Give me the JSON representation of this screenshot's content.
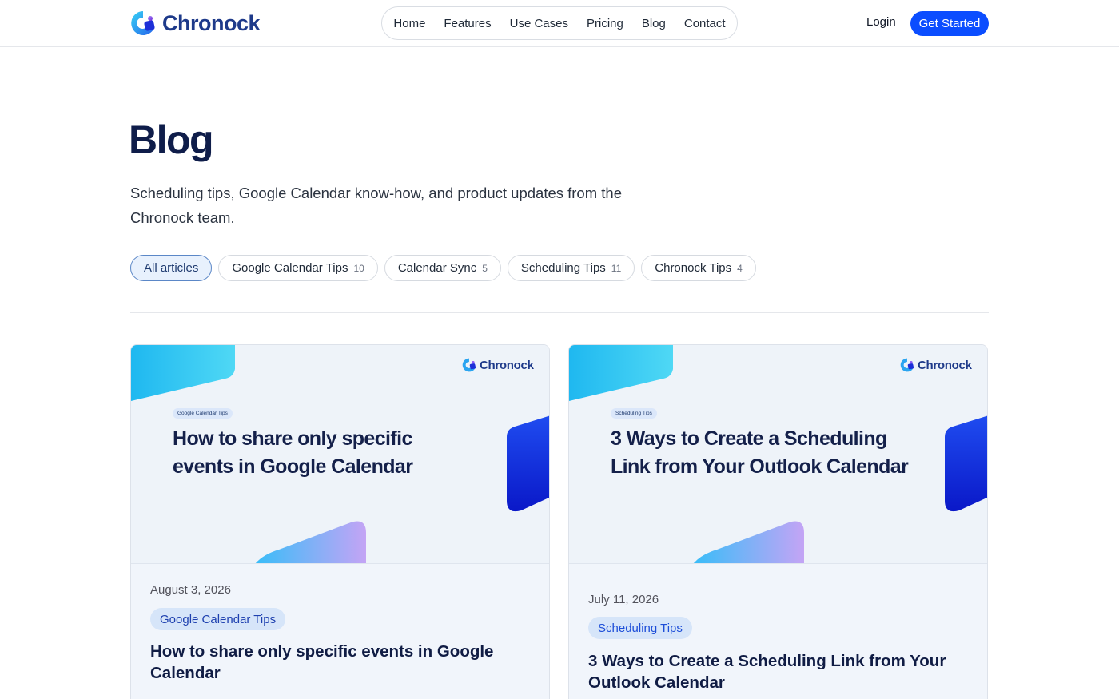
{
  "brand": {
    "name": "Chronock"
  },
  "nav": {
    "items": [
      "Home",
      "Features",
      "Use Cases",
      "Pricing",
      "Blog",
      "Contact"
    ]
  },
  "header": {
    "login": "Login",
    "cta": "Get Started"
  },
  "hero": {
    "title": "Blog",
    "subtitle": "Scheduling tips, Google Calendar know-how, and product updates from the Chronock team."
  },
  "filters": [
    {
      "label": "All articles",
      "count": "",
      "active": true
    },
    {
      "label": "Google Calendar Tips",
      "count": "10",
      "active": false
    },
    {
      "label": "Calendar Sync",
      "count": "5",
      "active": false
    },
    {
      "label": "Scheduling Tips",
      "count": "11",
      "active": false
    },
    {
      "label": "Chronock Tips",
      "count": "4",
      "active": false
    }
  ],
  "posts": [
    {
      "thumb_brand": "Chronock",
      "thumb_tag": "Google Calendar Tips",
      "thumb_title": "How to share only specific events in Google Calendar",
      "date": "August 3, 2026",
      "tag": "Google Calendar Tips",
      "title": "How to share only specific events in Google Calendar"
    },
    {
      "thumb_brand": "Chronock",
      "thumb_tag": "Scheduling Tips",
      "thumb_title": "3 Ways to Create a Scheduling Link from Your Outlook Calendar",
      "date": "July 11, 2026",
      "tag": "Scheduling Tips",
      "title": "3 Ways to Create a Scheduling Link from Your Outlook Calendar"
    }
  ],
  "colors": {
    "accent": "#0b4dff",
    "heading": "#0f1d4a",
    "chip_active_bg": "#e8f1fd",
    "tag_bg": "#d6e5f9"
  }
}
